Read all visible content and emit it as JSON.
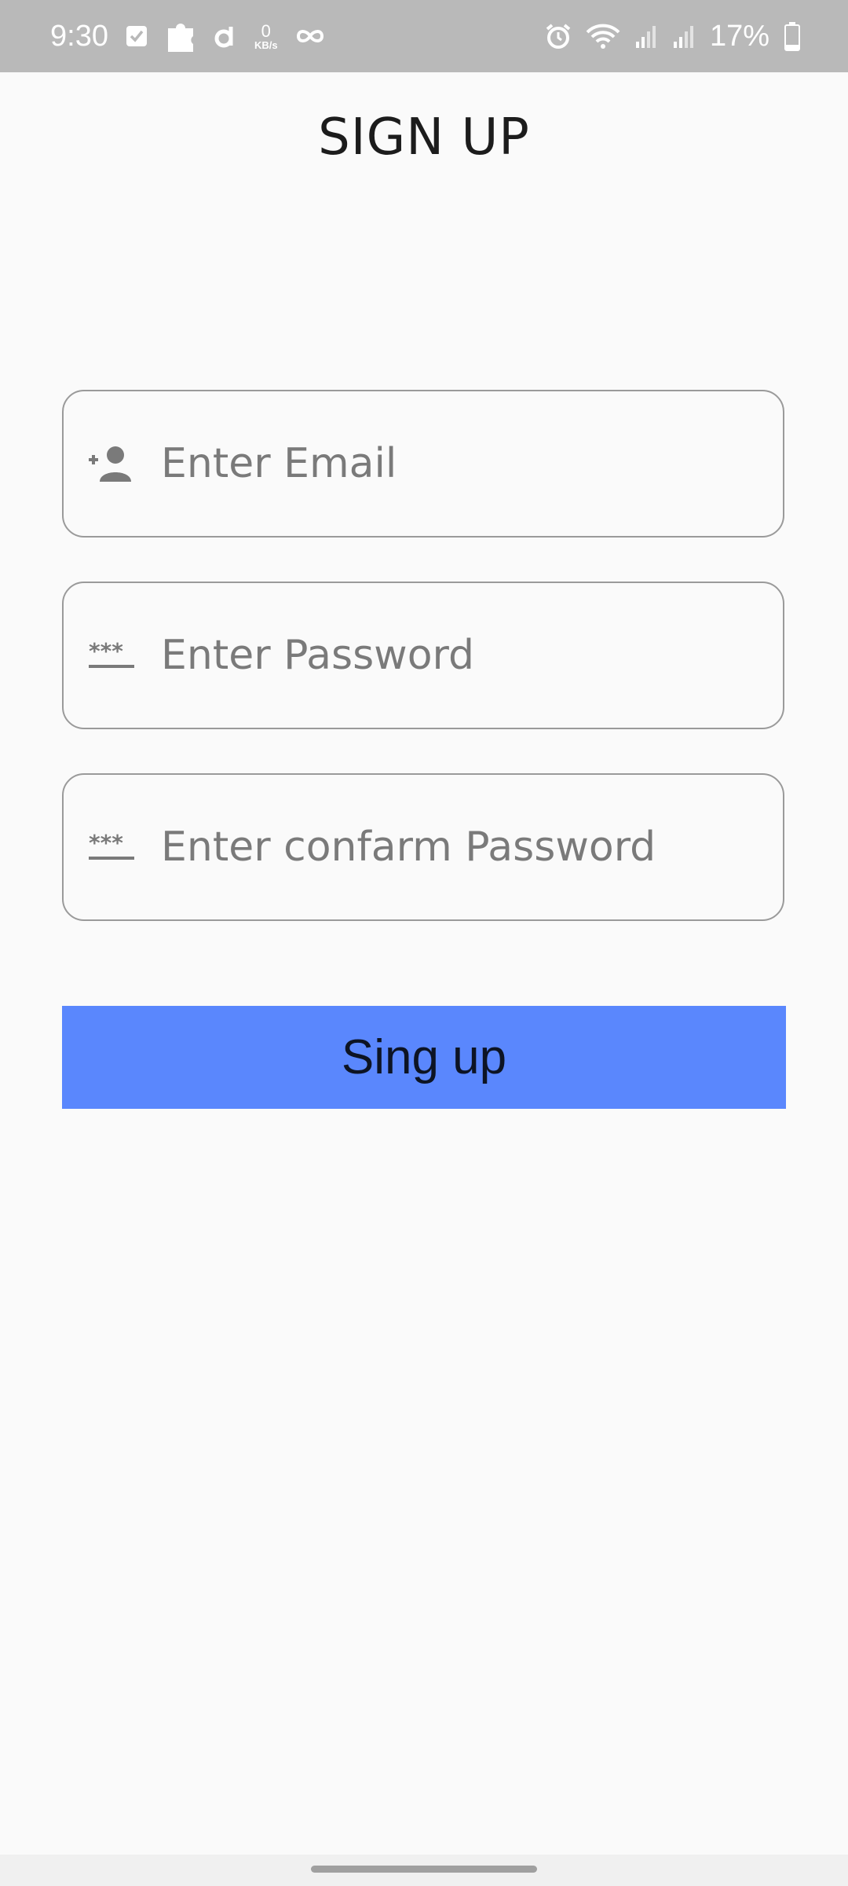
{
  "status_bar": {
    "time": "9:30",
    "speed_value": "0",
    "speed_unit": "KB/s",
    "battery_percent": "17%"
  },
  "page": {
    "title": "SIGN UP"
  },
  "form": {
    "email_placeholder": "Enter Email",
    "password_placeholder": "Enter Password",
    "confirm_placeholder": "Enter confarm Password",
    "submit_label": "Sing up"
  },
  "colors": {
    "status_bar": "#b9b9b9",
    "background": "#fafafa",
    "button": "#5a87fd",
    "field_border": "#9a9a9a"
  }
}
